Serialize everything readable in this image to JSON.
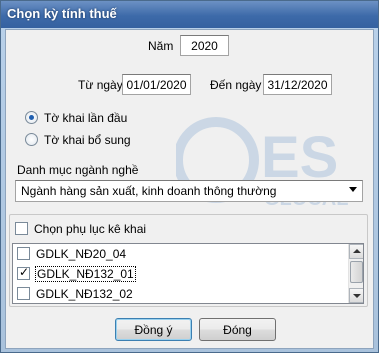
{
  "window": {
    "title": "Chọn kỳ tính thuế"
  },
  "year": {
    "label": "Năm",
    "value": "2020"
  },
  "from_date": {
    "label": "Từ ngày",
    "value": "01/01/2020"
  },
  "to_date": {
    "label": "Đến ngày",
    "value": "31/12/2020"
  },
  "declaration_type": {
    "options": [
      {
        "label": "Tờ khai lần đầu",
        "selected": true
      },
      {
        "label": "Tờ khai bổ sung",
        "selected": false
      }
    ]
  },
  "industry": {
    "label": "Danh mục ngành nghề",
    "value": "Ngành hàng sản xuất, kinh doanh thông thường"
  },
  "appendix": {
    "label": "Chọn phụ lục kê khai",
    "checked": false,
    "items": [
      {
        "label": "GDLK_NĐ20_04",
        "checked": false
      },
      {
        "label": "GDLK_NĐ132_01",
        "checked": true
      },
      {
        "label": "GDLK_NĐ132_02",
        "checked": false
      }
    ]
  },
  "buttons": {
    "ok": "Đồng ý",
    "close": "Đóng"
  },
  "watermark": {
    "text": "ES",
    "subtext": "GLOCAL"
  }
}
